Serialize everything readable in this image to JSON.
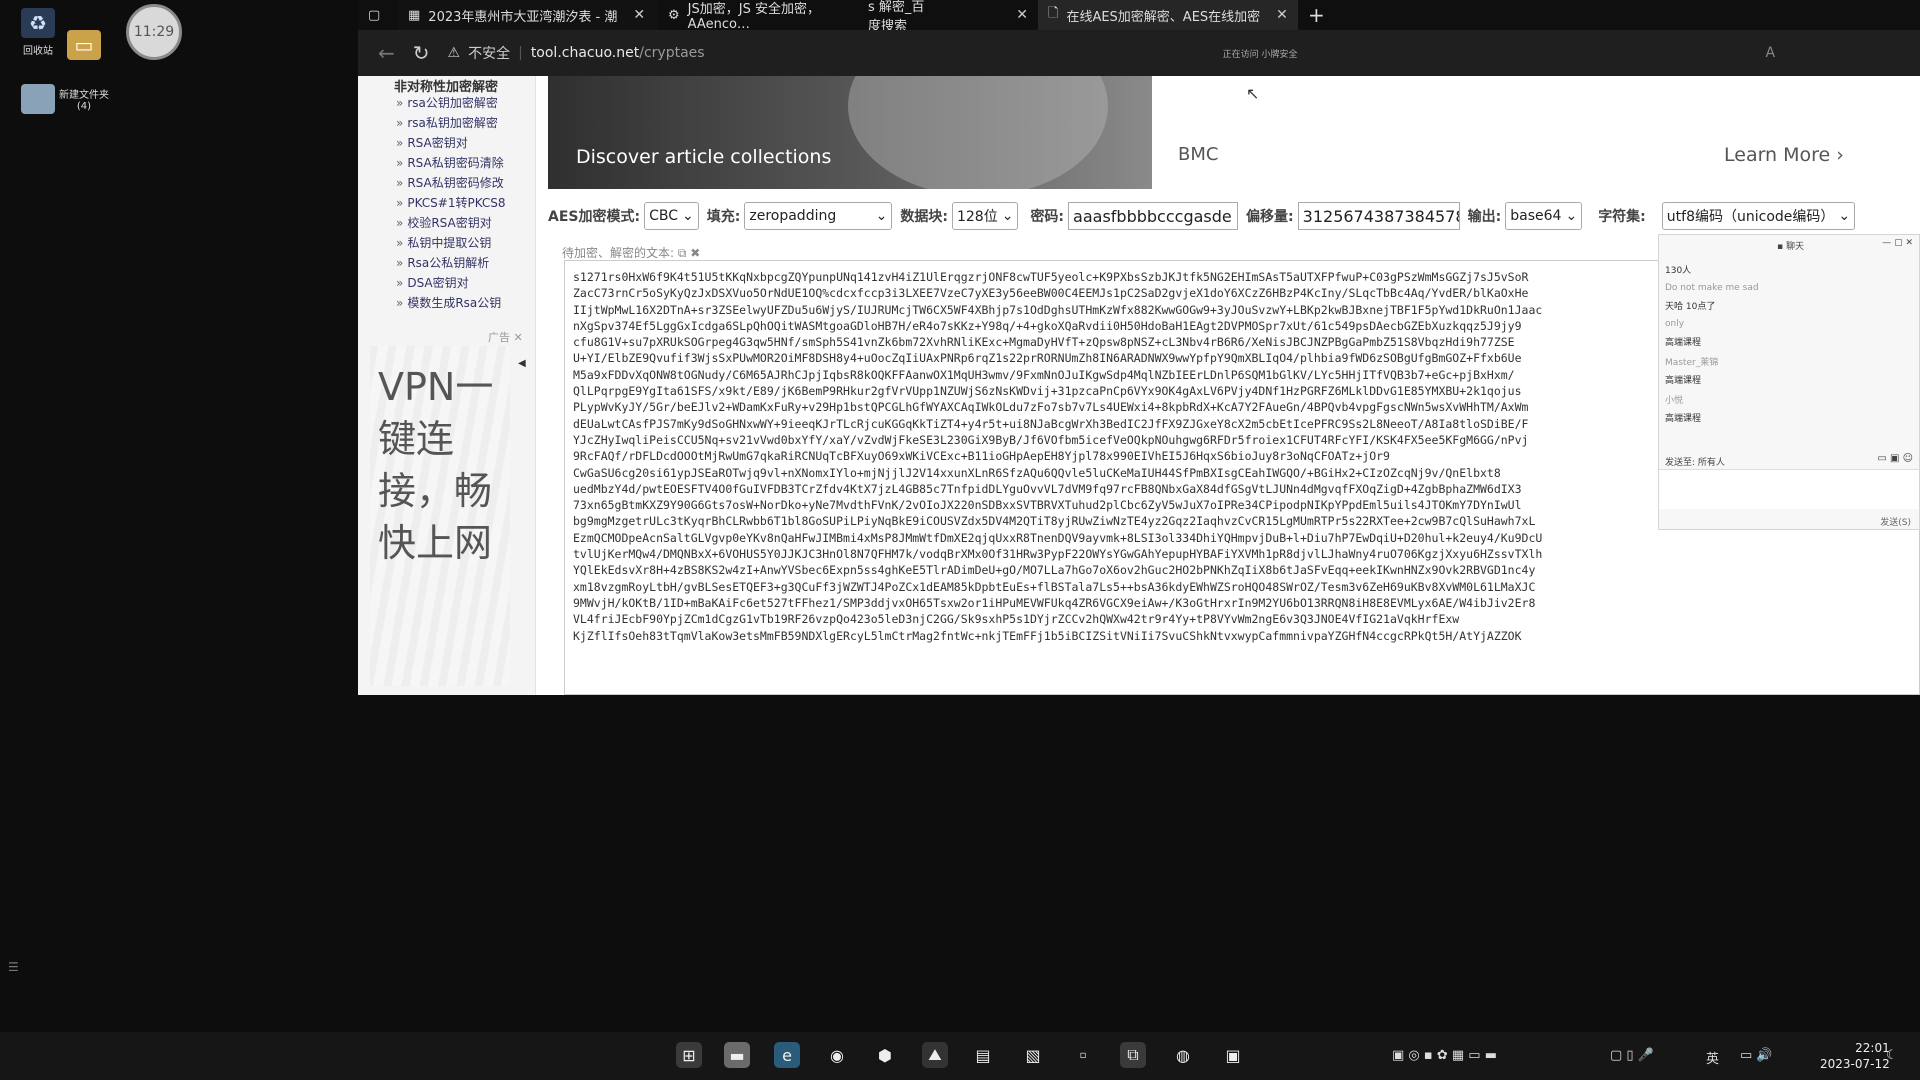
{
  "desktop": {
    "icons": [
      {
        "label": "回收站"
      },
      {
        "label": "新建文件夹\n(4)"
      }
    ],
    "clock_badge": "11:29"
  },
  "browser": {
    "tabs": [
      {
        "title": "2023年惠州市大亚湾潮汐表 - 潮"
      },
      {
        "title": "JS加密，JS 安全加密，AAenco…"
      },
      {
        "title": "s 解密_百度搜索"
      },
      {
        "title": "在线AES加密解密、AES在线加密"
      }
    ],
    "security_label": "不安全",
    "url_host": "tool.chacuo.net",
    "url_path": "/cryptaes",
    "status_text": "正在访问  小牌安全"
  },
  "sidebar": {
    "heading": "非对称性加密解密",
    "items": [
      "rsa公钥加密解密",
      "rsa私钥加密解密",
      "RSA密钥对",
      "RSA私钥密码清除",
      "RSA私钥密码修改",
      "PKCS#1转PKCS8",
      "校验RSA密钥对",
      "私钥中提取公钥",
      "Rsa公私钥解析",
      "DSA密钥对",
      "模数生成Rsa公钥"
    ],
    "ad_label": "广告",
    "ad_text": "VPN一键连接，畅快上网"
  },
  "banner": {
    "text": "Discover article collections",
    "brand": "BMC",
    "learn_more": "Learn More"
  },
  "form": {
    "mode_label": "AES加密模式:",
    "mode_value": "CBC",
    "padding_label": "填充:",
    "padding_value": "zeropadding",
    "block_label": "数据块:",
    "block_value": "128位",
    "key_label": "密码:",
    "key_value": "aaasfbbbbcccgasde",
    "iv_label": "偏移量:",
    "iv_value": "3125674387384578",
    "output_label": "输出:",
    "output_value": "base64",
    "charset_label": "字符集:",
    "charset_value": "utf8编码（unicode编码）",
    "text_label": "待加密、解密的文本:"
  },
  "ciphertext": [
    "s1271rs0HxW6f9K4t51U5tKKqNxbpcgZQYpunpUNq141zvH4iZ1UlErqgzrjONF8cwTUF5yeolc+K9PXbsSzbJKJtfk5NG2EHImSAsT5aUTXFPfwuP+C03gPSzWmMsGGZj7sJ5vSoR",
    "ZacC73rnCr5oSyKyQzJxDSXVuo5OrNdUE1OQ%cdcxfccp3i3LXEE7VzeC7yXE3y56eeBW00C4EEMJs1pC2SaD2gvjeX1doY6XCzZ6HBzP4KcIny/SLqcTbBc4Aq/YvdER/blKaOxHe",
    "IIjtWpMwL16X2DTnA+sr3ZSEelwyUFZDu5u6WjyS/IUJRUMcjTW6CX5WF4XBhjp7s1OdDghsUTHmKzWfx882KwwGOGw9+3yJOuSvzwY+LBKp2kwBJBxnejTBF1F5pYwd1DkRuOn1Jaac",
    "nXgSpv374Ef5LggGxIcdga6SLpQhOQitWASMtgoaGDloHB7H/eR4o7sKKz+Y98q/+4+gkoXQaRvdii0H50HdoBaH1EAgt2DVPMOSpr7xUt/61c549psDAecbGZEbXuzkqqz5J9jy9",
    "cfu8G1V+su7pXRUkSOGrpeg4G3qw5HNf/smSph5S41vnZk6bm72XvhRNliKExc+MgmaDyHVfT+zQpsw8pNSZ+cL3Nbv4rB6R6/XeNisJBCJNZPBgGaPmbZ51S8VbqzHdi9h77ZSE",
    "U+YI/ElbZE9Qvufif3WjsSxPUwMOR2OiMF8DSH8y4+uOocZqIiUAxPNRp6rqZ1s22prRORNUmZh8IN6ARADNWX9wwYpfpY9QmXBLIqO4/plhbia9fWD6zSOBgUfgBmGOZ+Ffxb6Ue",
    "M5a9xFDDvXqONW8tOGNudy/C6M65AJRhCJpjIqbsR8kOQKFFAanwOX1MqUH3wmv/9FxmNnOJuIKgwSdp4MqlNZbIEErLDnlP6SQM1bGlKV/LYc5HHjITfVQB3b7+eGc+pjBxHxm/",
    "QlLPqrpgE9YgIta61SFS/x9kt/E89/jK6BemP9RHkur2gfVrVUpp1NZUWjS6zNsKWDvij+31pzcaPnCp6VYx9OK4gAxLV6PVjy4DNf1HzPGRFZ6MLklDDvG1E85YMXBU+2k1qojus",
    "PLypWvKyJY/5Gr/beEJlv2+WDamKxFuRy+v29Hp1bstQPCGLhGfWYAXCAqIWkOLdu7zFo7sb7v7Ls4UEWxi4+8kpbRdX+KcA7Y2FAueGn/4BPQvb4vpgFgscNWn5wsXvWHhTM/AxWm",
    "dEUaLwtCAsfPJS7mKy9dSoGHNxwWY+9ieeqKJrTLcRjcuKGGqKkTiZT4+y4r5t+ui8NJaBcgWrXh3BedIC2JfFX9ZJGxeY8cX2m5cbEtIcePFRC9Ss2L8NeeoT/A8Ia8tloSDiBE/F",
    "YJcZHyIwqliPeisCCU5Nq+sv21vVwd0bxYfY/xaY/vZvdWjFkeSE3L230GiX9ByB/Jf6VOfbm5icefVeOQkpNOuhgwg6RFDr5froiex1CFUT4RFcYFI/KSK4FX5ee5KFgM6GG/nPvj",
    "9RcFAQf/rDFLDcdOOOtMjRwUmG7qkaRiRCNUqTcBFXuyO69xWKiVCExc+B11ioGHpAepEH8Yjpl78x990EIVhEI5J6HqxS6bioJuy8r3oNqCFOATz+jOr9",
    "CwGaSU6cg20si61ypJSEaROTwjq9vl+nXNomxIYlo+mjNjjlJ2V14xxunXLnR6SfzAQu6QQvle5luCKeMaIUH44SfPmBXIsgCEahIWGQO/+BGiHx2+CIzOZcqNj9v/QnElbxt8",
    "uedMbzY4d/pwtEOESFTV4O0fGuIVFDB3TCrZfdv4KtX7jzL4GB85c7TnfpidDLYguOvvVL7dVM9fq97rcFB8QNbxGaX84dfGSgVtLJUNn4dMgvqfFXOqZigD+4ZgbBphaZMW6dIX3",
    "73xn65gBtmKXZ9Y90G6Gts7osW+NorDko+yNe7MvdthFVnK/2vOIoJX220nSDBxxSVTBRVXTuhud2plCbc6ZyV5wJuX7oIPRe34CPipodpNIKpYPpdEml5uils4JTOKmY7DYnIwUl",
    "bg9mgMzgetrULc3tKyqrBhCLRwbb6T1bl8GoSUPiLPiyNqBkE9iCOUSVZdx5DV4M2QTiT8yjRUwZiwNzTE4yz2Gqz2IaqhvzCvCR15LgMUmRTPr5s22RXTee+2cw9B7cQlSuHawh7xL",
    "EzmQCMODpeAcnSaltGLVgvp0eYKv8nQaHFwJIMBmi4xMsP8JMmWtfDmXE2qjqUxxR8TnenDQV9ayvmk+8LSI3ol334DhiYQHmpvjDuB+l+Diu7hP7EwDqiU+D20hul+k2euy4/Ku9DcU",
    "tvlUjKerMQw4/DMQNBxX+6VOHUS5Y0JJKJC3HnOl8N7QFHM7k/vodqBrXMx0Of31HRw3PypF22OWYsYGwGAhYepupHYBAFiYXVMh1pR8djvlLJhaWny4ruO706KgzjXxyu6HZssvTXlh",
    "YQlEkEdsvXr8H+4zBS8KS2w4zI+AnwYVSbec6Expn5ss4ghKeE5TlrADimDeU+gO/MO7LLa7hGo7oX6ov2hGuc2HO2bPNKhZqIiX8b6tJaSFvEqq+eekIKwnHNZx9Ovk2RBVGD1nc4y",
    "xm18vzgmRoyLtbH/gvBLSesETQEF3+g3QCuFf3jWZWTJ4PoZCx1dEAM85kDpbtEuEs+flBSTala7Ls5++bsA36kdyEWhWZSroHQO48SWrOZ/Tesm3v6ZeH69uKBv8XvWM0L61LMaXJC",
    "9MWvjH/kOKtB/1ID+mBaKAiFc6et527tFFhez1/SMP3ddjvxOH65Tsxw2or1iHPuMEVWFUkq4ZR6VGCX9eiAw+/K3oGtHrxrIn9M2YU6bO13RRQN8iH8E8EVMLyx6AE/W4ibJiv2Er8",
    "VL4friJEcbF90YpjZCm1dCgzG1vTb19RF26vzpQo423o5leD3njC2GG/Sk9sxhP5s1DYjrZCCv2hQWXw42tr9r4Yy+tP8VYvWm2ngE6v3Q3JNOE4VfIG21aVqkHrfExw",
    "KjZflIfsOeh83tTqmVlaKow3etsMmFB59NDXlgERcyL5lmCtrMag2fntWc+nkjTEmFFj1b5iBCIZSitVNiIi7SvuCShkNtvxwypCafmmnivpaYZGHfN4ccgcRPkQt5H/AtYjAZZOK"
  ],
  "chat": {
    "title": "聊天",
    "lines": [
      {
        "text": "130人",
        "dim": false
      },
      {
        "text": "Do not make me sad",
        "dim": true
      },
      {
        "text": "天哈 10点了",
        "dim": false
      },
      {
        "text": "only",
        "dim": true
      },
      {
        "text": "高端课程",
        "dim": false
      },
      {
        "text": "Master_莱锦",
        "dim": true
      },
      {
        "text": "高端课程",
        "dim": false
      },
      {
        "text": "小悦",
        "dim": true
      },
      {
        "text": "高端课程",
        "dim": false
      }
    ],
    "send_to": "发送至:",
    "send_target": "所有人",
    "send_button": "发送(S)"
  },
  "taskbar": {
    "ime": "英",
    "time": "22:01",
    "date": "2023-07-12"
  }
}
